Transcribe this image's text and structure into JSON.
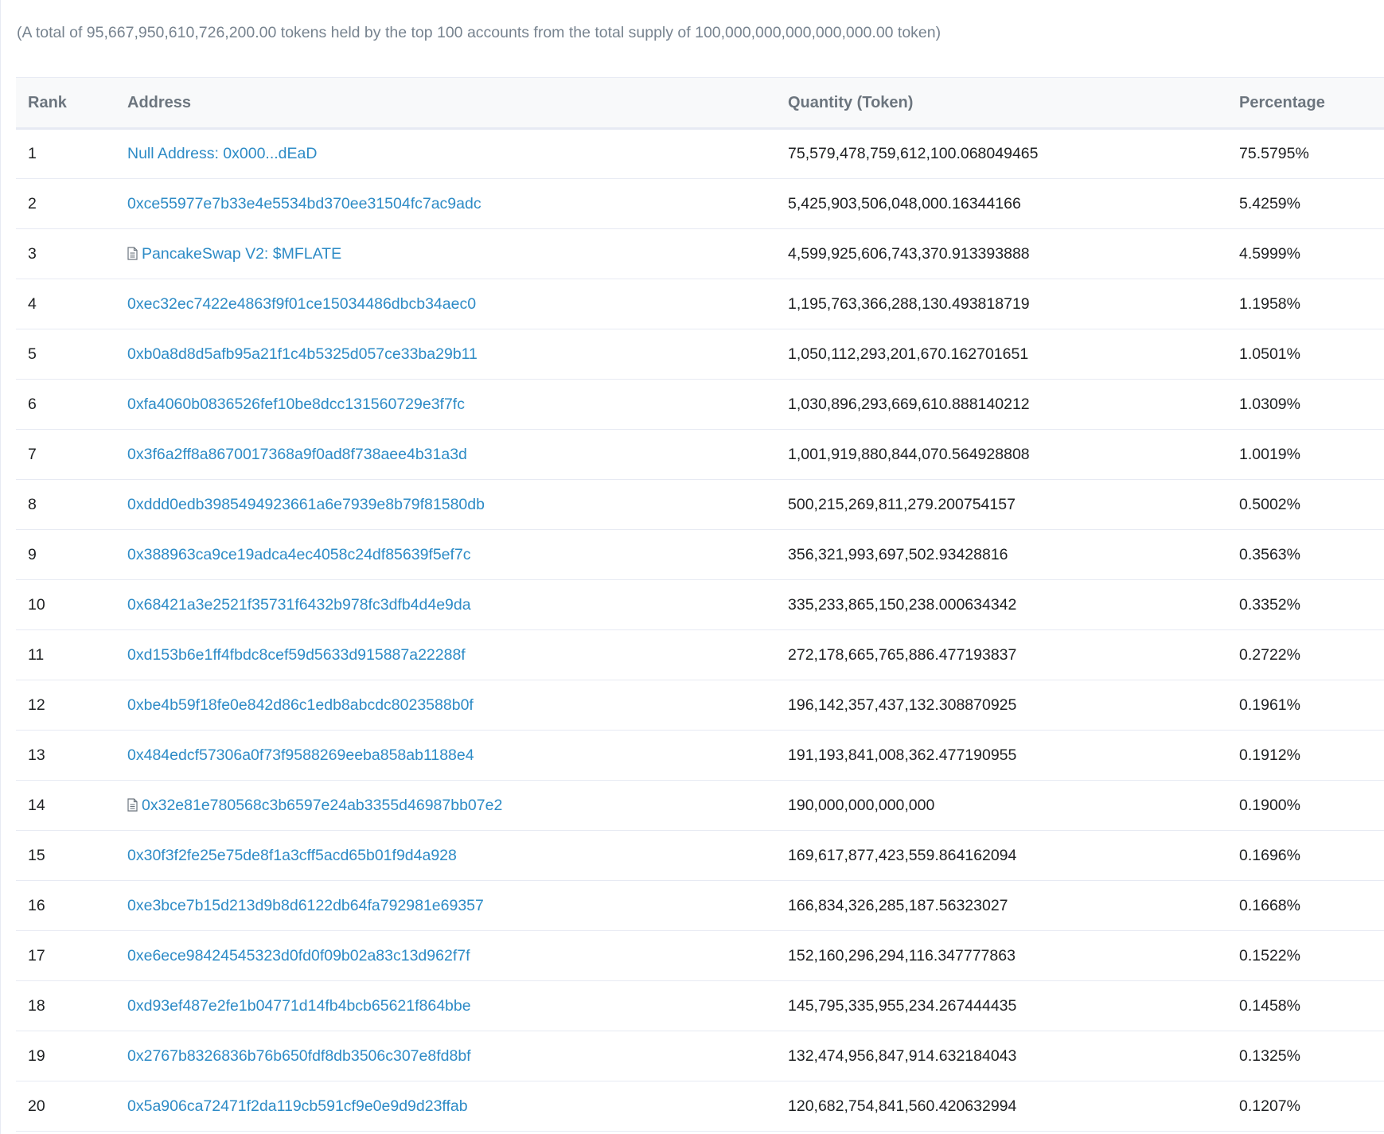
{
  "summary": {
    "text": "(A total of 95,667,950,610,726,200.00 tokens held by the top 100 accounts from the total supply of 100,000,000,000,000,000.00 token)"
  },
  "table": {
    "headers": {
      "rank": "Rank",
      "address": "Address",
      "quantity": "Quantity (Token)",
      "percentage": "Percentage"
    },
    "rows": [
      {
        "rank": "1",
        "address": "Null Address: 0x000...dEaD",
        "contract": false,
        "quantity": "75,579,478,759,612,100.068049465",
        "percentage": "75.5795%"
      },
      {
        "rank": "2",
        "address": "0xce55977e7b33e4e5534bd370ee31504fc7ac9adc",
        "contract": false,
        "quantity": "5,425,903,506,048,000.16344166",
        "percentage": "5.4259%"
      },
      {
        "rank": "3",
        "address": "PancakeSwap V2: $MFLATE",
        "contract": true,
        "quantity": "4,599,925,606,743,370.913393888",
        "percentage": "4.5999%"
      },
      {
        "rank": "4",
        "address": "0xec32ec7422e4863f9f01ce15034486dbcb34aec0",
        "contract": false,
        "quantity": "1,195,763,366,288,130.493818719",
        "percentage": "1.1958%"
      },
      {
        "rank": "5",
        "address": "0xb0a8d8d5afb95a21f1c4b5325d057ce33ba29b11",
        "contract": false,
        "quantity": "1,050,112,293,201,670.162701651",
        "percentage": "1.0501%"
      },
      {
        "rank": "6",
        "address": "0xfa4060b0836526fef10be8dcc131560729e3f7fc",
        "contract": false,
        "quantity": "1,030,896,293,669,610.888140212",
        "percentage": "1.0309%"
      },
      {
        "rank": "7",
        "address": "0x3f6a2ff8a8670017368a9f0ad8f738aee4b31a3d",
        "contract": false,
        "quantity": "1,001,919,880,844,070.564928808",
        "percentage": "1.0019%"
      },
      {
        "rank": "8",
        "address": "0xddd0edb3985494923661a6e7939e8b79f81580db",
        "contract": false,
        "quantity": "500,215,269,811,279.200754157",
        "percentage": "0.5002%"
      },
      {
        "rank": "9",
        "address": "0x388963ca9ce19adca4ec4058c24df85639f5ef7c",
        "contract": false,
        "quantity": "356,321,993,697,502.93428816",
        "percentage": "0.3563%"
      },
      {
        "rank": "10",
        "address": "0x68421a3e2521f35731f6432b978fc3dfb4d4e9da",
        "contract": false,
        "quantity": "335,233,865,150,238.000634342",
        "percentage": "0.3352%"
      },
      {
        "rank": "11",
        "address": "0xd153b6e1ff4fbdc8cef59d5633d915887a22288f",
        "contract": false,
        "quantity": "272,178,665,765,886.477193837",
        "percentage": "0.2722%"
      },
      {
        "rank": "12",
        "address": "0xbe4b59f18fe0e842d86c1edb8abcdc8023588b0f",
        "contract": false,
        "quantity": "196,142,357,437,132.308870925",
        "percentage": "0.1961%"
      },
      {
        "rank": "13",
        "address": "0x484edcf57306a0f73f9588269eeba858ab1188e4",
        "contract": false,
        "quantity": "191,193,841,008,362.477190955",
        "percentage": "0.1912%"
      },
      {
        "rank": "14",
        "address": "0x32e81e780568c3b6597e24ab3355d46987bb07e2",
        "contract": true,
        "quantity": "190,000,000,000,000",
        "percentage": "0.1900%"
      },
      {
        "rank": "15",
        "address": "0x30f3f2fe25e75de8f1a3cff5acd65b01f9d4a928",
        "contract": false,
        "quantity": "169,617,877,423,559.864162094",
        "percentage": "0.1696%"
      },
      {
        "rank": "16",
        "address": "0xe3bce7b15d213d9b8d6122db64fa792981e69357",
        "contract": false,
        "quantity": "166,834,326,285,187.56323027",
        "percentage": "0.1668%"
      },
      {
        "rank": "17",
        "address": "0xe6ece98424545323d0fd0f09b02a83c13d962f7f",
        "contract": false,
        "quantity": "152,160,296,294,116.347777863",
        "percentage": "0.1522%"
      },
      {
        "rank": "18",
        "address": "0xd93ef487e2fe1b04771d14fb4bcb65621f864bbe",
        "contract": false,
        "quantity": "145,795,335,955,234.267444435",
        "percentage": "0.1458%"
      },
      {
        "rank": "19",
        "address": "0x2767b8326836b76b650fdf8db3506c307e8fd8bf",
        "contract": false,
        "quantity": "132,474,956,847,914.632184043",
        "percentage": "0.1325%"
      },
      {
        "rank": "20",
        "address": "0x5a906ca72471f2da119cb591cf9e0e9d9d23ffab",
        "contract": false,
        "quantity": "120,682,754,841,560.420632994",
        "percentage": "0.1207%"
      }
    ]
  },
  "colors": {
    "link": "#2d8bc6",
    "muted_text": "#77838f",
    "header_text": "#6c757e",
    "header_bg": "#f8f9fa",
    "border": "#e7eaf3"
  },
  "icons": {
    "contract": "file-text-icon"
  }
}
